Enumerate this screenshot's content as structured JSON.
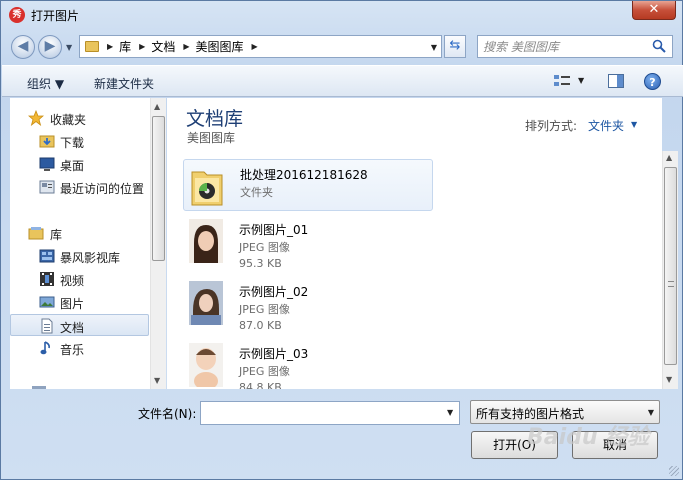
{
  "window": {
    "title": "打开图片",
    "close_label": "✕",
    "app_icon_text": "秀"
  },
  "address": {
    "breadcrumbs": [
      "库",
      "文档",
      "美图图库"
    ]
  },
  "search": {
    "placeholder": "搜索 美图图库"
  },
  "toolbar": {
    "organize_label": "组织 ▼",
    "new_folder_label": "新建文件夹",
    "help_label": "?"
  },
  "sidebar": {
    "items": [
      {
        "label": "收藏夹",
        "icon": "star-icon"
      },
      {
        "label": "下载",
        "icon": "download-folder-icon"
      },
      {
        "label": "桌面",
        "icon": "desktop-icon"
      },
      {
        "label": "最近访问的位置",
        "icon": "recent-places-icon"
      },
      {
        "label": "库",
        "icon": "library-icon"
      },
      {
        "label": "暴风影视库",
        "icon": "video-library-icon"
      },
      {
        "label": "视频",
        "icon": "video-icon"
      },
      {
        "label": "图片",
        "icon": "pictures-icon"
      },
      {
        "label": "文档",
        "icon": "documents-icon",
        "selected": true
      },
      {
        "label": "音乐",
        "icon": "music-icon"
      }
    ]
  },
  "content": {
    "library_title": "文档库",
    "library_subtitle": "美图图库",
    "arrange_label": "排列方式:",
    "arrange_value": "文件夹",
    "files": [
      {
        "name": "批处理201612181628",
        "type": "文件夹",
        "size": "",
        "icon": "folder-icon"
      },
      {
        "name": "示例图片_01",
        "type": "JPEG 图像",
        "size": "95.3 KB",
        "icon": "photo-thumbnail"
      },
      {
        "name": "示例图片_02",
        "type": "JPEG 图像",
        "size": "87.0 KB",
        "icon": "photo-thumbnail"
      },
      {
        "name": "示例图片_03",
        "type": "JPEG 图像",
        "size": "84.8 KB",
        "icon": "photo-thumbnail"
      }
    ]
  },
  "footer": {
    "filename_label": "文件名(N):",
    "filename_value": "",
    "filter_value": "所有支持的图片格式",
    "open_label": "打开(O)",
    "cancel_label": "取消"
  },
  "watermark": "Baidu 经验",
  "colors": {
    "title_blue": "#1e3f75",
    "link_blue": "#1e57a3",
    "close_red": "#c7503a"
  }
}
